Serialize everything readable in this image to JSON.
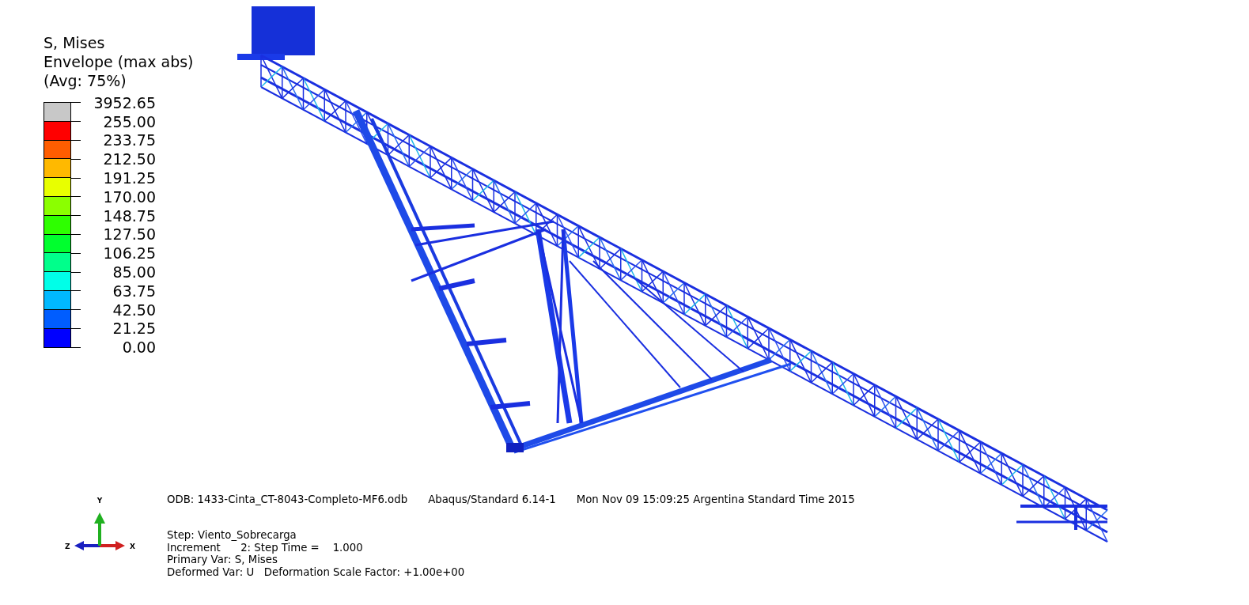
{
  "legend": {
    "title_lines": [
      "S, Mises",
      "Envelope (max abs)",
      "(Avg: 75%)"
    ],
    "bands": [
      {
        "color": "#c8c8c8"
      },
      {
        "color": "#ff0000"
      },
      {
        "color": "#ff5d00"
      },
      {
        "color": "#ffb900"
      },
      {
        "color": "#e8ff00"
      },
      {
        "color": "#8bff00"
      },
      {
        "color": "#2eff00"
      },
      {
        "color": "#00ff2e"
      },
      {
        "color": "#00ff8b"
      },
      {
        "color": "#00ffe8"
      },
      {
        "color": "#00b9ff"
      },
      {
        "color": "#005dff"
      },
      {
        "color": "#0000ff"
      }
    ],
    "tick_labels": [
      "3952.65",
      "255.00",
      "233.75",
      "212.50",
      "191.25",
      "170.00",
      "148.75",
      "127.50",
      "106.25",
      "85.00",
      "63.75",
      "42.50",
      "21.25",
      "0.00"
    ]
  },
  "triad": {
    "y_label": "Y",
    "z_label": "Z",
    "x_label": "X"
  },
  "info": {
    "header": [
      "ODB: 1433-Cinta_CT-8043-Completo-MF6.odb",
      "Abaqus/Standard 6.14-1",
      "Mon Nov 09 15:09:25 Argentina Standard Time 2015"
    ],
    "lines": [
      "Step: Viento_Sobrecarga",
      "Increment      2: Step Time =    1.000",
      "Primary Var: S, Mises",
      "Deformed Var: U   Deformation Scale Factor: +1.00e+00"
    ]
  }
}
